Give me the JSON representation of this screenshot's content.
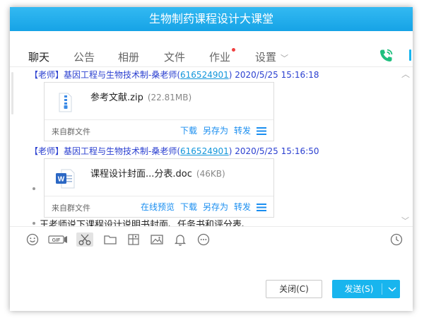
{
  "window": {
    "title": "生物制药课程设计大课堂"
  },
  "tabs": [
    {
      "label": "聊天",
      "active": true
    },
    {
      "label": "公告"
    },
    {
      "label": "相册"
    },
    {
      "label": "文件"
    },
    {
      "label": "作业",
      "badge": "red-dot"
    },
    {
      "label": "设置",
      "has_dropdown": true
    }
  ],
  "header_icons": [
    "phone-icon"
  ],
  "messages": [
    {
      "type": "file",
      "sender": {
        "role": "【老师】",
        "name": "基因工程与生物技术制-桑老师(",
        "qq": "616524901",
        "suffix": ")",
        "time": "2020/5/25 15:16:18"
      },
      "file": {
        "icon": "zip-icon",
        "name": "参考文献.zip",
        "size": "(22.81MB)",
        "source": "来自群文件",
        "actions": [
          "下载",
          "另存为",
          "转发"
        ]
      }
    },
    {
      "type": "file",
      "sender": {
        "role": "【老师】",
        "name": "基因工程与生物技术制-桑老师(",
        "qq": "616524901",
        "suffix": ")",
        "time": "2020/5/25 15:16:50"
      },
      "file": {
        "icon": "word-doc-icon",
        "name": "课程设计封面...分表.doc",
        "size": "(46KB)",
        "source": "来自群文件",
        "actions": [
          "在线预览",
          "下载",
          "另存为",
          "转发"
        ]
      }
    },
    {
      "type": "text",
      "text": "王老师说下课程设计说明书封面、任务书和评分表、"
    }
  ],
  "toolbar_icons": [
    "emoji-icon",
    "gif-icon",
    "scissors-icon",
    "folder-icon",
    "file-transfer-icon",
    "image-icon",
    "bell-icon",
    "more-icon",
    "history-clock-icon"
  ],
  "buttons": {
    "close": "关闭(C)",
    "send": "发送(S)"
  },
  "colors": {
    "accent": "#18b5ee",
    "sender": "#2a3fd0",
    "link": "#1a8ef0",
    "qq_link": "#1296db"
  }
}
